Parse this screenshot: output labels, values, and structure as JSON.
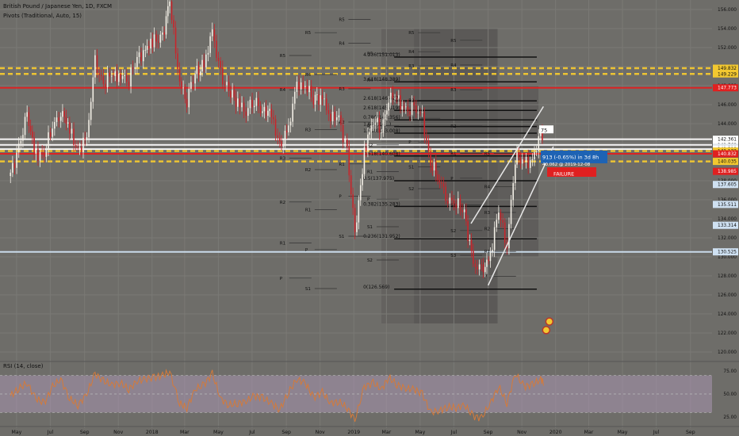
{
  "header": {
    "symbol_line": "British Pound / Japanese Yen, 1D, FXCM",
    "pivots_label": "Pivots (Traditional, Auto, 15)",
    "rsi_label": "RSI (14, close)"
  },
  "colors": {
    "background": "#6e6d69",
    "grid": "#7a7975",
    "up_candle": "#f3efe6",
    "down_candle": "#c9252b",
    "support_red": "#e02020",
    "resistance_yellow": "#f2c830",
    "white_level": "#ffffff",
    "trend_line": "#e8e8e8",
    "rsi_band": "#a996b0",
    "rsi_line": "#d47a3a",
    "highlight_zone": "#8a8986"
  },
  "chart_data": {
    "type": "candlestick",
    "symbol": "GBPJPY",
    "ylim": [
      119.5,
      157.0
    ],
    "y_ticks": [
      "156.000",
      "154.000",
      "152.000",
      "150.000",
      "148.000",
      "146.000",
      "144.000",
      "142.000",
      "140.000",
      "138.000",
      "136.000",
      "134.000",
      "132.000",
      "130.000",
      "128.000",
      "126.000",
      "124.000",
      "122.000",
      "120.000"
    ],
    "x_ticks": [
      "May",
      "Jul",
      "Sep",
      "Nov",
      "2018",
      "Mar",
      "May",
      "Jul",
      "Sep",
      "Nov",
      "2019",
      "Mar",
      "May",
      "Jul",
      "Sep",
      "Nov",
      "2020",
      "Mar",
      "May",
      "Jul",
      "Sep"
    ],
    "price_series": [
      {
        "t": "2017-04-20",
        "v": 138.5
      },
      {
        "t": "2017-05-05",
        "v": 141.8
      },
      {
        "t": "2017-05-20",
        "v": 144.5
      },
      {
        "t": "2017-06-05",
        "v": 141.0
      },
      {
        "t": "2017-06-20",
        "v": 140.8
      },
      {
        "t": "2017-07-05",
        "v": 143.6
      },
      {
        "t": "2017-07-20",
        "v": 145.6
      },
      {
        "t": "2017-08-05",
        "v": 143.0
      },
      {
        "t": "2017-08-20",
        "v": 141.4
      },
      {
        "t": "2017-09-05",
        "v": 142.2
      },
      {
        "t": "2017-09-20",
        "v": 150.4
      },
      {
        "t": "2017-10-05",
        "v": 148.3
      },
      {
        "t": "2017-10-20",
        "v": 148.9
      },
      {
        "t": "2017-11-05",
        "v": 149.4
      },
      {
        "t": "2017-11-20",
        "v": 148.4
      },
      {
        "t": "2017-12-05",
        "v": 151.0
      },
      {
        "t": "2017-12-20",
        "v": 151.8
      },
      {
        "t": "2018-01-05",
        "v": 152.5
      },
      {
        "t": "2018-01-20",
        "v": 153.4
      },
      {
        "t": "2018-02-02",
        "v": 156.6
      },
      {
        "t": "2018-02-20",
        "v": 148.7
      },
      {
        "t": "2018-03-05",
        "v": 146.5
      },
      {
        "t": "2018-03-20",
        "v": 149.3
      },
      {
        "t": "2018-04-05",
        "v": 150.3
      },
      {
        "t": "2018-04-20",
        "v": 153.3
      },
      {
        "t": "2018-05-05",
        "v": 149.4
      },
      {
        "t": "2018-05-20",
        "v": 147.2
      },
      {
        "t": "2018-06-05",
        "v": 146.4
      },
      {
        "t": "2018-06-20",
        "v": 145.6
      },
      {
        "t": "2018-07-05",
        "v": 146.1
      },
      {
        "t": "2018-07-20",
        "v": 145.8
      },
      {
        "t": "2018-08-05",
        "v": 144.6
      },
      {
        "t": "2018-08-20",
        "v": 141.5
      },
      {
        "t": "2018-09-05",
        "v": 143.6
      },
      {
        "t": "2018-09-20",
        "v": 147.8
      },
      {
        "t": "2018-10-05",
        "v": 148.4
      },
      {
        "t": "2018-10-20",
        "v": 146.4
      },
      {
        "t": "2018-11-05",
        "v": 147.0
      },
      {
        "t": "2018-11-20",
        "v": 144.7
      },
      {
        "t": "2018-12-05",
        "v": 144.3
      },
      {
        "t": "2018-12-20",
        "v": 141.4
      },
      {
        "t": "2019-01-03",
        "v": 131.9
      },
      {
        "t": "2019-01-20",
        "v": 141.4
      },
      {
        "t": "2019-02-05",
        "v": 144.3
      },
      {
        "t": "2019-02-20",
        "v": 143.3
      },
      {
        "t": "2019-03-05",
        "v": 147.0
      },
      {
        "t": "2019-03-20",
        "v": 146.4
      },
      {
        "t": "2019-04-05",
        "v": 145.6
      },
      {
        "t": "2019-04-20",
        "v": 145.4
      },
      {
        "t": "2019-05-05",
        "v": 144.6
      },
      {
        "t": "2019-05-20",
        "v": 139.9
      },
      {
        "t": "2019-06-05",
        "v": 137.9
      },
      {
        "t": "2019-06-20",
        "v": 136.4
      },
      {
        "t": "2019-07-05",
        "v": 135.4
      },
      {
        "t": "2019-07-20",
        "v": 134.8
      },
      {
        "t": "2019-08-05",
        "v": 129.1
      },
      {
        "t": "2019-08-20",
        "v": 128.3
      },
      {
        "t": "2019-09-05",
        "v": 130.5
      },
      {
        "t": "2019-09-20",
        "v": 134.6
      },
      {
        "t": "2019-10-05",
        "v": 131.4
      },
      {
        "t": "2019-10-20",
        "v": 140.4
      },
      {
        "t": "2019-11-05",
        "v": 139.9
      },
      {
        "t": "2019-11-20",
        "v": 140.4
      },
      {
        "t": "2019-12-05",
        "v": 142.4
      },
      {
        "t": "2019-12-11",
        "v": 141.9
      }
    ],
    "rsi": {
      "ylim": [
        20,
        80
      ],
      "ticks": [
        "75.00",
        "50.00",
        "25.00"
      ],
      "band": [
        30,
        70
      ],
      "values": [
        48,
        56,
        62,
        45,
        40,
        58,
        66,
        45,
        38,
        50,
        72,
        64,
        60,
        62,
        55,
        64,
        66,
        68,
        70,
        74,
        40,
        35,
        55,
        60,
        72,
        45,
        38,
        40,
        42,
        48,
        46,
        40,
        33,
        52,
        66,
        62,
        46,
        52,
        40,
        42,
        35,
        22,
        58,
        62,
        55,
        68,
        60,
        56,
        55,
        50,
        30,
        32,
        36,
        35,
        38,
        26,
        24,
        40,
        58,
        40,
        72,
        58,
        60,
        66,
        62
      ]
    },
    "right_labels": [
      {
        "text": "149.832",
        "color": "#f2c830",
        "textColor": "#111"
      },
      {
        "text": "149.229",
        "color": "#f2c830",
        "textColor": "#111"
      },
      {
        "text": "147.773",
        "color": "#e02020",
        "textColor": "#fff"
      },
      {
        "text": "142.361",
        "color": "#ffffff",
        "textColor": "#111"
      },
      {
        "text": "141.769",
        "color": "#ffffff",
        "textColor": "#111"
      },
      {
        "text": "141.520",
        "color": "#dfe6ee",
        "textColor": "#111"
      },
      {
        "text": "141.318",
        "color": "#ffffff",
        "textColor": "#111"
      },
      {
        "text": "141.122",
        "color": "#f2c830",
        "textColor": "#111"
      },
      {
        "text": "140.832",
        "color": "#e02020",
        "textColor": "#fff"
      },
      {
        "text": "140.035",
        "color": "#f2c830",
        "textColor": "#111"
      },
      {
        "text": "138.985",
        "color": "#e02020",
        "textColor": "#fff"
      },
      {
        "text": "137.605",
        "color": "#cfe1f2",
        "textColor": "#111"
      },
      {
        "text": "135.511",
        "color": "#cfe1f2",
        "textColor": "#111"
      },
      {
        "text": "133.314",
        "color": "#cfe1f2",
        "textColor": "#111"
      },
      {
        "text": "130.525",
        "color": "#cfe1f2",
        "textColor": "#111"
      }
    ],
    "horizontal_levels": [
      {
        "y": 149.832,
        "color": "#f2c830",
        "dash": true
      },
      {
        "y": 149.229,
        "color": "#f2c830",
        "dash": true
      },
      {
        "y": 147.773,
        "color": "#e02020",
        "dash": false
      },
      {
        "y": 142.361,
        "color": "#ffffff",
        "dash": false
      },
      {
        "y": 141.769,
        "color": "#ffffff",
        "dash": false
      },
      {
        "y": 141.318,
        "color": "#ffffff",
        "dash": false
      },
      {
        "y": 141.122,
        "color": "#f2c830",
        "dash": true
      },
      {
        "y": 140.832,
        "color": "#e02020",
        "dash": false
      },
      {
        "y": 140.035,
        "color": "#f2c830",
        "dash": true
      },
      {
        "y": 130.525,
        "color": "#cfe1f2",
        "dash": false
      }
    ],
    "fib_labels": [
      {
        "text": "4.236(151.013)",
        "y": 151.0
      },
      {
        "text": "3.618(148.389)",
        "y": 148.4
      },
      {
        "text": "2.618(145.419)",
        "y": 145.4
      },
      {
        "text": "2.618(146.427)",
        "y": 146.4
      },
      {
        "text": "1.618(143.008)",
        "y": 143.0
      },
      {
        "text": "1.618(14...)",
        "y": 143.7
      },
      {
        "text": "0.786(144.356)",
        "y": 144.4
      },
      {
        "text": "0.618(140.608)",
        "y": 140.6
      },
      {
        "text": "0.5(137.975)",
        "y": 138.0
      },
      {
        "text": "0.382(135.283)",
        "y": 135.3
      },
      {
        "text": "0.236(131.952)",
        "y": 131.9
      },
      {
        "text": "0(126.569)",
        "y": 126.6
      }
    ],
    "pivot_labels": [
      "R5",
      "R4",
      "R3",
      "R2",
      "R1",
      "P",
      "S1",
      "S2",
      "S3",
      "S4",
      "S5"
    ],
    "annotations": {
      "countdown": "913 (-0.65%) in 3d 8h",
      "date_line": "40.062 @ 2019-12-08",
      "failure": "FAILURE",
      "price_tag": "75"
    }
  }
}
